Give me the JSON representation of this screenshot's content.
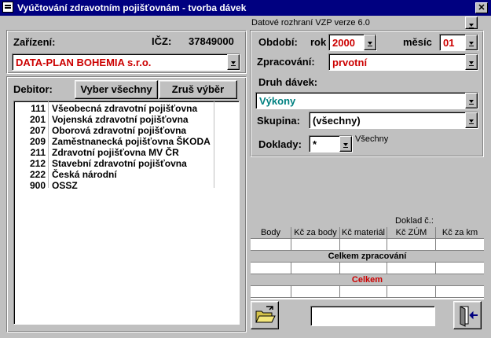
{
  "window": {
    "title": "Vyúčtování zdravotním pojišťovnám - tvorba dávek"
  },
  "interface_label": "Datové rozhraní VZP verze 6.0",
  "left": {
    "zarizeni_label": "Zařízení:",
    "icz_label": "IČZ:",
    "icz_value": "37849000",
    "zarizeni_value": "DATA-PLAN BOHEMIA s.r.o.",
    "debitor_label": "Debitor:",
    "select_all": "Vyber všechny",
    "clear_selection": "Zruš výběr",
    "debitors": [
      {
        "code": "111",
        "name": "Všeobecná zdravotní pojišťovna"
      },
      {
        "code": "201",
        "name": "Vojenská zdravotní pojišťovna"
      },
      {
        "code": "207",
        "name": "Oborová zdravotní pojišťovna"
      },
      {
        "code": "209",
        "name": "Zaměstnanecká pojišťovna ŠKODA"
      },
      {
        "code": "211",
        "name": "Zdravotní pojišťovna MV ČR"
      },
      {
        "code": "212",
        "name": "Stavební zdravotní pojišťovna"
      },
      {
        "code": "222",
        "name": "Česká národní"
      },
      {
        "code": "900",
        "name": "OSSZ"
      }
    ]
  },
  "right": {
    "obdobi_label": "Období:",
    "rok_label": "rok",
    "rok_value": "2000",
    "mesic_label": "měsíc",
    "mesic_value": "01",
    "zpracovani_label": "Zpracování:",
    "zpracovani_value": "prvotní",
    "druh_label": "Druh dávek:",
    "druh_value": "Výkony",
    "skupina_label": "Skupina:",
    "skupina_value": "(všechny)",
    "doklady_label": "Doklady:",
    "doklady_value": "*",
    "doklady_note": "Všechny"
  },
  "summary": {
    "doklad_label": "Doklad č.:",
    "columns": [
      "Body",
      "Kč za body",
      "Kč materiál",
      "Kč ZÚM",
      "Kč za km"
    ],
    "processed_label": "Celkem zpracování",
    "total_label": "Celkem"
  },
  "colors": {
    "title_bar": "#000080",
    "accent_red": "#cc0000",
    "accent_teal": "#008080"
  }
}
